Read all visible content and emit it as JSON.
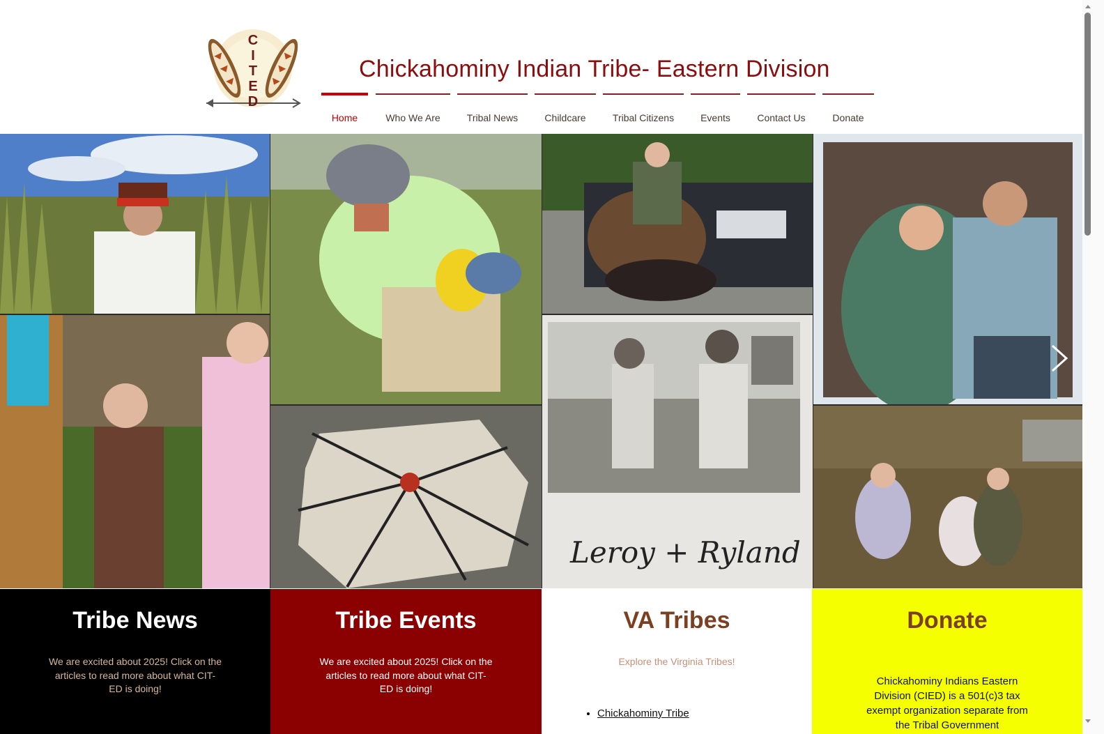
{
  "header": {
    "site_title": "Chickahominy Indian Tribe- Eastern Division",
    "logo_text": "CITED"
  },
  "nav": {
    "items": [
      {
        "label": "Home",
        "active": true
      },
      {
        "label": "Who We Are"
      },
      {
        "label": "Tribal News"
      },
      {
        "label": "Childcare"
      },
      {
        "label": "Tribal Citizens"
      },
      {
        "label": "Events"
      },
      {
        "label": "Contact Us"
      },
      {
        "label": "Donate"
      }
    ]
  },
  "gallery": {
    "photo_caption_handwritten": "Leroy + Ryland",
    "next_icon": "chevron-right-icon"
  },
  "panels": {
    "news": {
      "title": "Tribe News",
      "text": "We are excited about 2025! Click on the articles to read more about what CIT-ED is doing!"
    },
    "events": {
      "title": "Tribe Events",
      "text": "We are excited about 2025! Click on the articles to read more about what CIT-ED is doing!"
    },
    "tribes": {
      "title": "VA Tribes",
      "text": "Explore the Virginia Tribes!",
      "links": [
        "Chickahominy Tribe"
      ]
    },
    "donate": {
      "title": "Donate",
      "text": "Chickahominy Indians Eastern Division (CIED) is a 501(c)3 tax exempt organization separate from the Tribal Government"
    }
  },
  "colors": {
    "title_red": "#8b0d0d",
    "active_nav": "#c40000",
    "events_bg": "#8b0000",
    "donate_bg": "#f5ff00",
    "heading_brown": "#7b3f22"
  }
}
